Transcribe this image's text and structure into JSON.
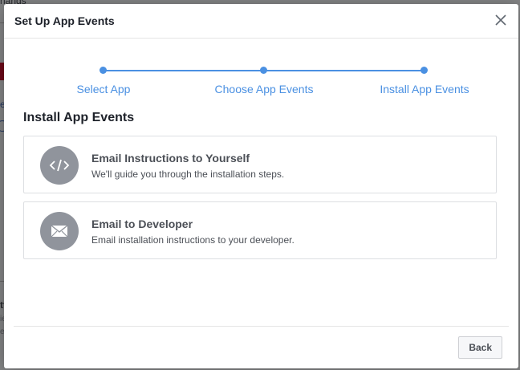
{
  "background": {
    "fragment_top": "rlands",
    "fragment_e": "e",
    "fragment_bottom_1": "tt",
    "fragment_bottom_2": "ie",
    "fragment_bottom_3": "e"
  },
  "dialog": {
    "title": "Set Up App Events",
    "close_icon": "close-icon"
  },
  "stepper": {
    "color": "#4a90e2",
    "steps": [
      {
        "label": "Select App"
      },
      {
        "label": "Choose App Events"
      },
      {
        "label": "Install App Events"
      }
    ]
  },
  "main": {
    "section_title": "Install App Events",
    "options": [
      {
        "icon": "code-icon",
        "title": "Email Instructions to Yourself",
        "description": "We'll guide you through the installation steps."
      },
      {
        "icon": "envelope-icon",
        "title": "Email to Developer",
        "description": "Email installation instructions to your developer."
      }
    ]
  },
  "footer": {
    "back_label": "Back"
  }
}
